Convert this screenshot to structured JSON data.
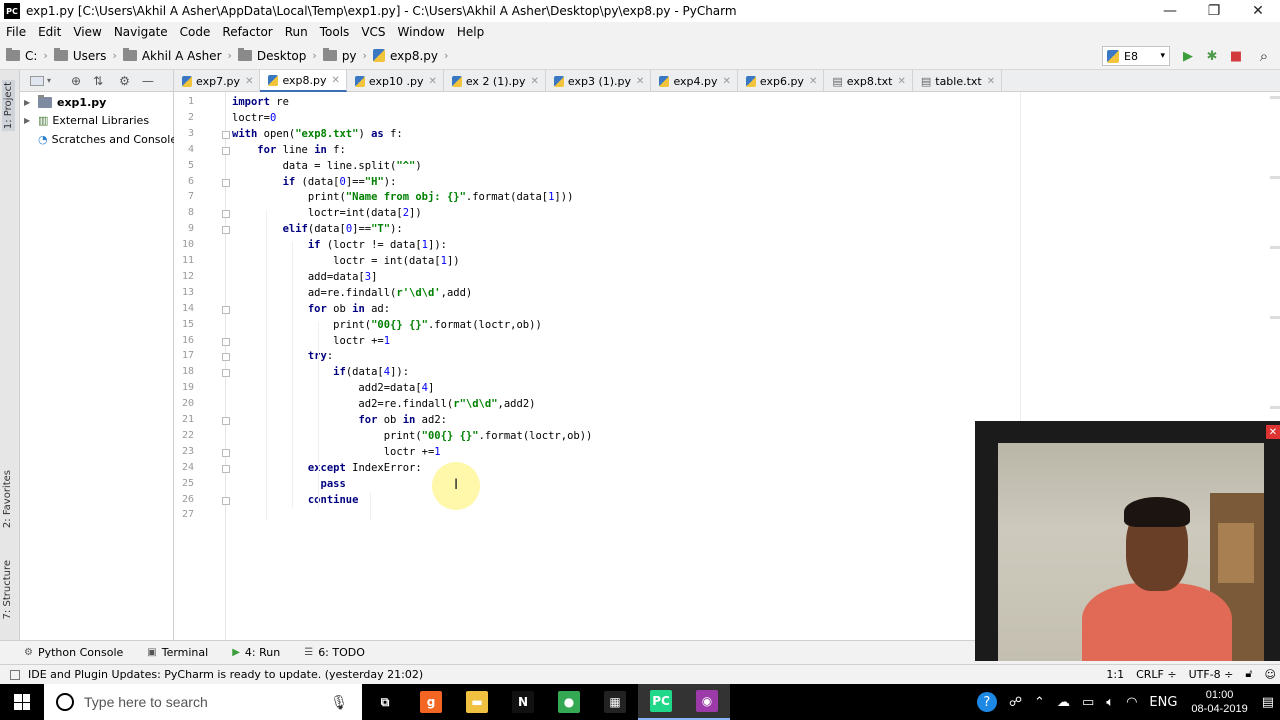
{
  "window": {
    "title": "exp1.py [C:\\Users\\Akhil A Asher\\AppData\\Local\\Temp\\exp1.py] - C:\\Users\\Akhil A Asher\\Desktop\\py\\exp8.py - PyCharm",
    "logo": "PC",
    "minimize": "—",
    "restore": "❐",
    "close": "✕"
  },
  "menu": [
    "File",
    "Edit",
    "View",
    "Navigate",
    "Code",
    "Refactor",
    "Run",
    "Tools",
    "VCS",
    "Window",
    "Help"
  ],
  "breadcrumbs": [
    "C:",
    "Users",
    "Akhil A Asher",
    "Desktop",
    "py",
    "exp8.py"
  ],
  "run_config": {
    "label": "E8",
    "arrow": "▾"
  },
  "toolbar_icons": {
    "run": "▶",
    "debug": "✱",
    "stop": "■",
    "search": "⌕"
  },
  "left_tool_tabs": [
    "1: Project",
    "2: Favorites",
    "7: Structure"
  ],
  "project_tree": [
    {
      "label": "exp1.py",
      "bold": true
    },
    {
      "label": "External Libraries",
      "bold": false
    },
    {
      "label": "Scratches and Consoles",
      "bold": false
    }
  ],
  "tabs": [
    {
      "label": "exp7.py",
      "active": false
    },
    {
      "label": "exp8.py",
      "active": true
    },
    {
      "label": "exp10 .py",
      "active": false
    },
    {
      "label": "ex 2 (1).py",
      "active": false
    },
    {
      "label": "exp3 (1).py",
      "active": false
    },
    {
      "label": "exp4.py",
      "active": false
    },
    {
      "label": "exp6.py",
      "active": false
    },
    {
      "label": "exp8.txt",
      "active": false
    },
    {
      "label": "table.txt",
      "active": false
    }
  ],
  "code_lines": [
    "import re",
    "loctr=0",
    "with open(\"exp8.txt\") as f:",
    "    for line in f:",
    "        data = line.split(\"^\")",
    "        if (data[0]==\"H\"):",
    "            print(\"Name from obj: {}\".format(data[1]))",
    "            loctr=int(data[2])",
    "        elif(data[0]==\"T\"):",
    "            if (loctr != data[1]):",
    "                loctr = int(data[1])",
    "            add=data[3]",
    "            ad=re.findall(r'\\d\\d',add)",
    "            for ob in ad:",
    "                print(\"00{} {}\".format(loctr,ob))",
    "                loctr +=1",
    "            try:",
    "                if(data[4]):",
    "                    add2=data[4]",
    "                    ad2=re.findall(r\"\\d\\d\",add2)",
    "                    for ob in ad2:",
    "                        print(\"00{} {}\".format(loctr,ob))",
    "                        loctr +=1",
    "            except IndexError:",
    "              pass",
    "            continue",
    ""
  ],
  "bottom_tools": [
    {
      "icon": "python-console-icon",
      "glyph": "⚙",
      "label": "Python Console"
    },
    {
      "icon": "terminal-icon",
      "glyph": "▣",
      "label": "Terminal"
    },
    {
      "icon": "run-icon",
      "glyph": "▶",
      "label": "4: Run"
    },
    {
      "icon": "todo-icon",
      "glyph": "☰",
      "label": "6: TODO"
    }
  ],
  "status": {
    "message": "IDE and Plugin Updates: PyCharm is ready to update. (yesterday 21:02)",
    "position": "1:1",
    "line_sep": "CRLF ÷",
    "encoding": "UTF-8 ÷"
  },
  "taskbar": {
    "search_placeholder": "Type here to search",
    "apps": [
      {
        "name": "task-view",
        "glyph": "⧉",
        "color": "#000000"
      },
      {
        "name": "g-app",
        "glyph": "g",
        "color": "#f26522"
      },
      {
        "name": "file-explorer",
        "glyph": "▬",
        "color": "#f0c040"
      },
      {
        "name": "netflix",
        "glyph": "N",
        "color": "#111111"
      },
      {
        "name": "chrome",
        "glyph": "●",
        "color": "#34a853"
      },
      {
        "name": "calendar",
        "glyph": "▦",
        "color": "#222222"
      },
      {
        "name": "pycharm",
        "glyph": "PC",
        "color": "#21d789"
      },
      {
        "name": "screen-recorder",
        "glyph": "◉",
        "color": "#9b3aa8"
      }
    ],
    "tray_lang": "ENG",
    "time": "01:00",
    "date": "08-04-2019"
  }
}
